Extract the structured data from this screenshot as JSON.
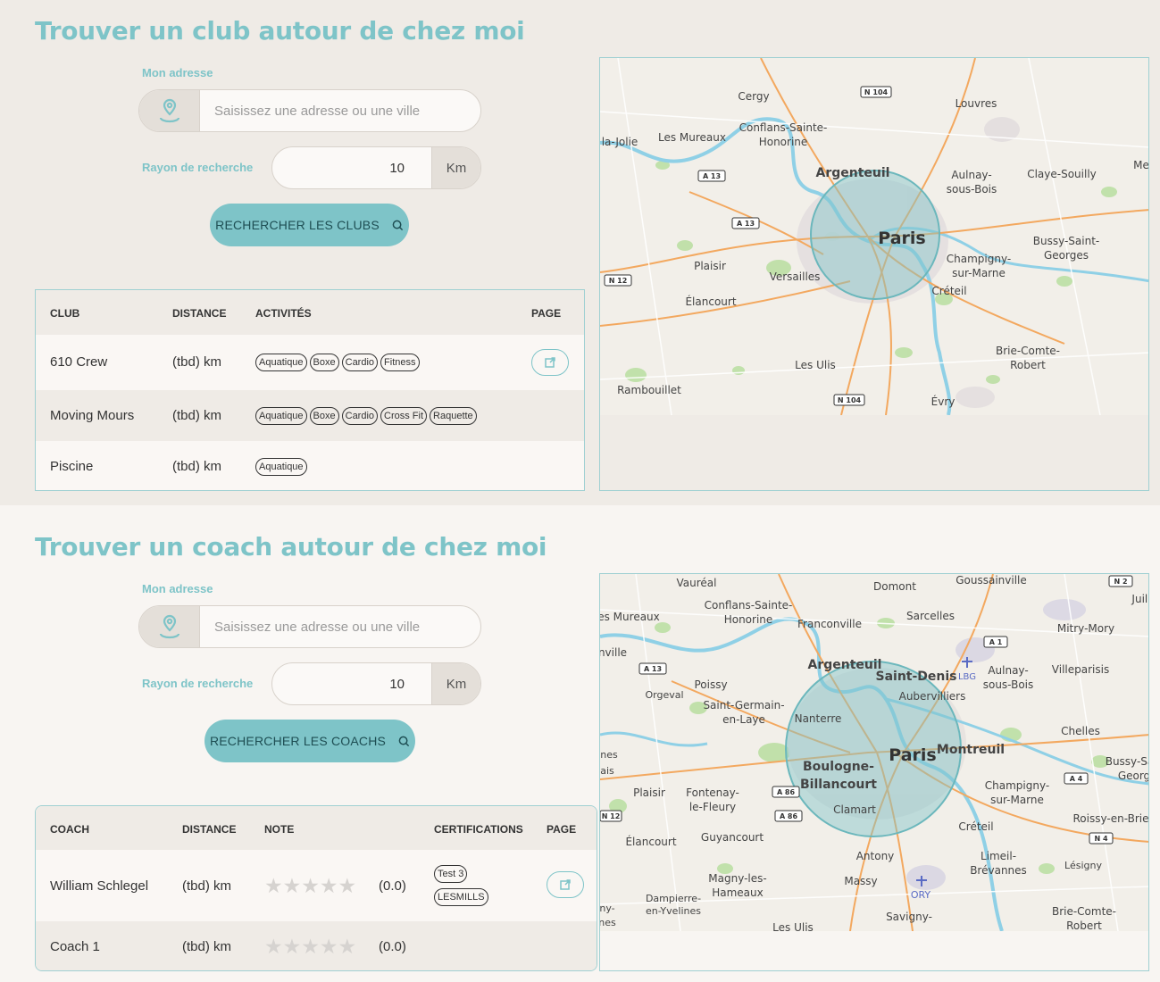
{
  "clubs": {
    "title": "Trouver un club autour de chez moi",
    "address_label": "Mon adresse",
    "address_placeholder": "Saisissez une adresse ou une ville",
    "radius_label": "Rayon de recherche",
    "radius_value": "10",
    "radius_unit": "Km",
    "search_button": "RECHERCHER LES CLUBS",
    "columns": [
      "CLUB",
      "DISTANCE",
      "ACTIVITÉS",
      "PAGE"
    ],
    "rows": [
      {
        "name": "610 Crew",
        "distance": "(tbd) km",
        "activities": [
          "Aquatique",
          "Boxe",
          "Cardio",
          "Fitness"
        ],
        "has_page": true
      },
      {
        "name": "Moving Mours",
        "distance": "(tbd) km",
        "activities": [
          "Aquatique",
          "Boxe",
          "Cardio",
          "Cross Fit",
          "Raquette"
        ],
        "has_page": false
      },
      {
        "name": "Piscine",
        "distance": "(tbd) km",
        "activities": [
          "Aquatique"
        ],
        "has_page": false
      }
    ],
    "map": {
      "places": [
        "Cergy",
        "Louvres",
        "Conflans-Sainte-",
        "Honorine",
        "Les Mureaux",
        "la-Jolie",
        "Argenteuil",
        "Aulnay-",
        "sous-Bois",
        "Claye-Souilly",
        "Paris",
        "Bussy-Saint-",
        "Georges",
        "Champigny-",
        "sur-Marne",
        "Plaisir",
        "Versailles",
        "Créteil",
        "Élancourt",
        "Brie-Comte-",
        "Robert",
        "Les Ulis",
        "Rambouillet",
        "Évry",
        "Me"
      ],
      "roads": [
        "N 104",
        "A 13",
        "A 13",
        "N 12",
        "N 104"
      ]
    }
  },
  "coach": {
    "title": "Trouver un coach autour de chez moi",
    "address_label": "Mon adresse",
    "address_placeholder": "Saisissez une adresse ou une ville",
    "radius_label": "Rayon de recherche",
    "radius_value": "10",
    "radius_unit": "Km",
    "search_button": "RECHERCHER LES COACHS",
    "columns": [
      "COACH",
      "DISTANCE",
      "NOTE",
      "CERTIFICATIONS",
      "PAGE"
    ],
    "rows": [
      {
        "name": "William Schlegel",
        "distance": "(tbd) km",
        "rating": "(0.0)",
        "rating_value": 0,
        "rating_max": 5,
        "certifications": [
          "Test 3",
          "LESMILLS"
        ],
        "has_page": true
      },
      {
        "name": "Coach 1",
        "distance": "(tbd) km",
        "rating": "(0.0)",
        "rating_value": 0,
        "rating_max": 5,
        "certifications": [],
        "has_page": false
      }
    ],
    "map": {
      "places": [
        "Vauréal",
        "Domont",
        "Goussainville",
        "Juill",
        "es Mureaux",
        "Conflans-Sainte-",
        "Honorine",
        "Franconville",
        "Sarcelles",
        "Mitry-Mory",
        "nville",
        "Argenteuil",
        "Saint-Denis",
        "Aulnay-",
        "sous-Bois",
        "Villeparisis",
        "Orgeval",
        "Poissy",
        "Aubervilliers",
        "Saint-Germain-",
        "en-Laye",
        "Nanterre",
        "Chelles",
        "nes",
        "ais",
        "Paris",
        "Montreuil",
        "Bussy-Sa",
        "Georg",
        "Boulogne-",
        "Billancourt",
        "Plaisir",
        "Fontenay-",
        "le-Fleury",
        "Champigny-",
        "sur-Marne",
        "Clamart",
        "Roissy-en-Brie",
        "Créteil",
        "Élancourt",
        "Guyancourt",
        "Limeil-",
        "Brévannes",
        "Antony",
        "Lésigny",
        "Magny-les-",
        "Hameaux",
        "Massy",
        "ORY",
        "Dampierre-",
        "en-Yvelines",
        "ny-",
        "nes",
        "Brie-Comte-",
        "Robert",
        "Savigny-",
        "Les Ulis",
        "LBG"
      ],
      "roads": [
        "N 2",
        "A 1",
        "A 13",
        "A 86",
        "A 86",
        "A 4",
        "N 12",
        "N 4"
      ]
    }
  },
  "colors": {
    "accent": "#7ec4c8",
    "section_bg_1": "#efebe6",
    "section_bg_2": "#f8f5f2",
    "map_land": "#f2efe9",
    "map_water": "#8fd0e6",
    "map_park": "#b9dea0"
  },
  "icons": {
    "address": "map-pin-icon",
    "search": "search-icon",
    "external": "external-link-icon",
    "star": "star-icon"
  }
}
